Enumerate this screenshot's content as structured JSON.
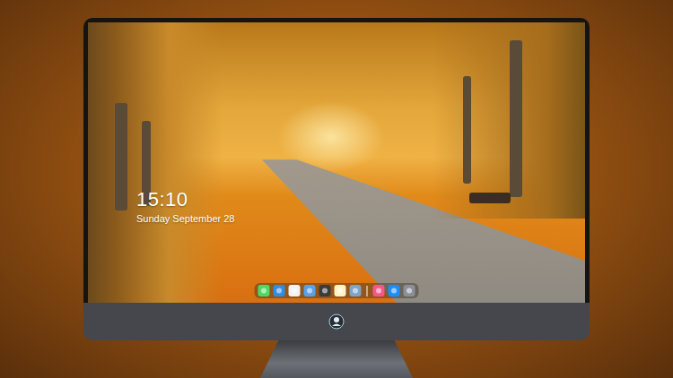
{
  "desktop": {
    "clock": "15:10",
    "date": "Sunday September 28"
  },
  "dock": {
    "items": [
      {
        "kind": "app",
        "color": "#4cd964"
      },
      {
        "kind": "app",
        "color": "#2f8de4"
      },
      {
        "kind": "app",
        "color": "#f2f2f2"
      },
      {
        "kind": "app",
        "color": "#5aa0e8"
      },
      {
        "kind": "app",
        "color": "#3b3b3b"
      },
      {
        "kind": "app",
        "color": "#fff3c4"
      },
      {
        "kind": "app",
        "color": "#7ea4c8"
      },
      {
        "kind": "separator",
        "color": "#ffffff"
      },
      {
        "kind": "app",
        "color": "#f5578a"
      },
      {
        "kind": "app",
        "color": "#1c8ef9"
      },
      {
        "kind": "app",
        "color": "#8a8f98"
      }
    ]
  }
}
